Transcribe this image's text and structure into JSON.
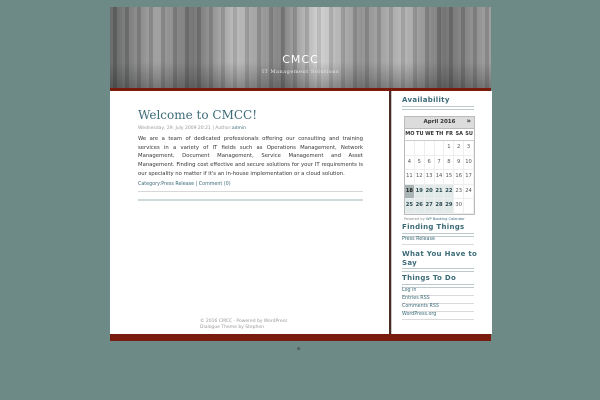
{
  "site": {
    "title": "CMCC",
    "tagline": "IT Management Solutions"
  },
  "post": {
    "title": "Welcome to CMCC!",
    "date": "Wednesday, 29. July 2009 20:21",
    "author_label": "| Author:",
    "author": "admin",
    "body": "We are a team of dedicated professionals offering our consulting and training services in a variety of IT fields such as Operations Management, Network Management, Document Management, Service Management and Asset Management. Finding cost effective and secure solutions for your IT requirements is our speciality no matter if it's an in-house implementation or a cloud solution.",
    "category_label": "Category:",
    "category": "Press Release",
    "separator": "|",
    "comments": "Comment (0)"
  },
  "footer": {
    "line1": "© 2016 CMCC · Powered by WordPress",
    "line2": "Dialogue Theme by Stephen"
  },
  "sidebar": {
    "availability": {
      "heading": "Availability",
      "calendar": {
        "month": "April 2016",
        "next_icon": "»",
        "weekdays": [
          "MO",
          "TU",
          "WE",
          "TH",
          "FR",
          "SA",
          "SU"
        ],
        "weeks": [
          [
            "",
            "",
            "",
            "",
            "1",
            "2",
            "3"
          ],
          [
            "4",
            "5",
            "6",
            "7",
            "8",
            "9",
            "10"
          ],
          [
            "11",
            "12",
            "13",
            "14",
            "15",
            "16",
            "17"
          ],
          [
            "18",
            "19",
            "20",
            "21",
            "22",
            "23",
            "24"
          ],
          [
            "25",
            "26",
            "27",
            "28",
            "29",
            "30",
            ""
          ]
        ],
        "today": "18",
        "available": [
          "19",
          "20",
          "21",
          "22",
          "25",
          "26",
          "27",
          "28",
          "29"
        ],
        "credit_prefix": "Powered by",
        "credit_link": "WP Booking Calendar"
      }
    },
    "finding_things": {
      "heading": "Finding Things",
      "links": [
        "Press Release"
      ]
    },
    "what_you_have": {
      "heading": "What You Have to Say"
    },
    "things_to_do": {
      "heading": "Things To Do",
      "links": [
        "Log in",
        "Entries RSS",
        "Comments RSS",
        "WordPress.org"
      ]
    }
  },
  "page_marker": "a"
}
